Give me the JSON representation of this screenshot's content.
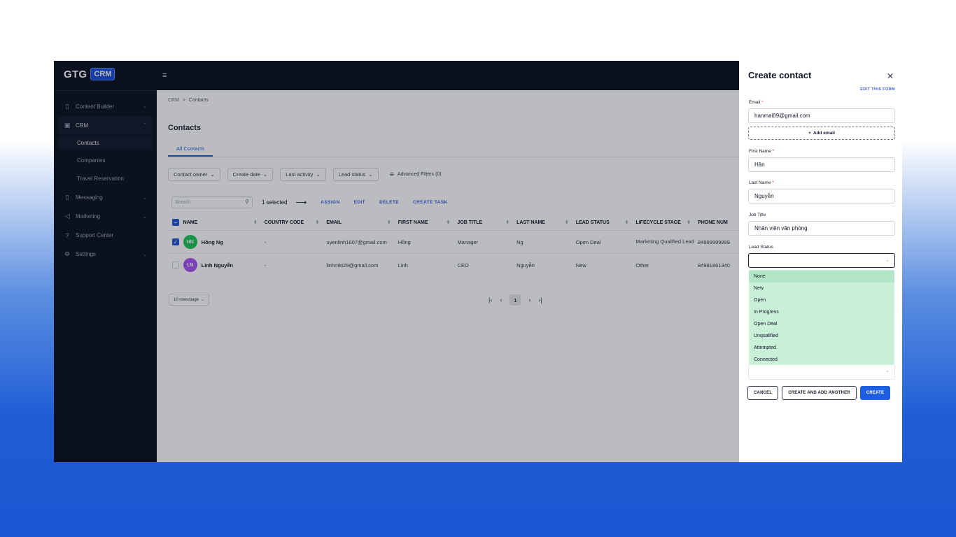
{
  "brand": {
    "name": "GTG",
    "badge": "CRM"
  },
  "sidebar": {
    "items": [
      {
        "label": "Content Builder",
        "icon": "bookmark-icon"
      },
      {
        "label": "CRM",
        "icon": "crm-icon"
      },
      {
        "label": "Messaging",
        "icon": "bookmark-icon"
      },
      {
        "label": "Marketing",
        "icon": "megaphone-icon"
      },
      {
        "label": "Support Center",
        "icon": "help-icon"
      },
      {
        "label": "Settings",
        "icon": "gear-icon"
      }
    ],
    "crm_sub": [
      "Contacts",
      "Companies",
      "Travel Reservation"
    ]
  },
  "breadcrumb": {
    "root": "CRM",
    "sep": ">",
    "current": "Contacts"
  },
  "page": {
    "title": "Contacts",
    "tab": "All Contacts"
  },
  "filters": [
    "Contact owner",
    "Create date",
    "Last activity",
    "Lead status"
  ],
  "advanced_filters": "Advanced Filters (0)",
  "toolbar": {
    "search_placeholder": "Search",
    "selected": "1 selected",
    "actions": [
      "ASSIGN",
      "EDIT",
      "DELETE",
      "CREATE TASK"
    ]
  },
  "table": {
    "headers": [
      "NAME",
      "COUNTRY CODE",
      "EMAIL",
      "FIRST NAME",
      "JOB TITLE",
      "LAST NAME",
      "LEAD STATUS",
      "LIFECYCLE STAGE",
      "PHONE NUM"
    ],
    "rows": [
      {
        "initials": "HN",
        "avatar_color": "#22c55e",
        "checked": true,
        "name": "Hồng Ng",
        "country": "-",
        "email": "uyenlinh1607@gmail.com",
        "first": "Hồng",
        "job": "Manager",
        "last": "Ng",
        "lead": "Open Deal",
        "stage": "Marketing Qualified Lead",
        "phone": "84999999999"
      },
      {
        "initials": "LN",
        "avatar_color": "#a855f7",
        "checked": false,
        "name": "Linh Nguyễn",
        "country": "-",
        "email": "linhmkt29@gmail.com",
        "first": "Linh",
        "job": "CEO",
        "last": "Nguyễn",
        "lead": "New",
        "stage": "Other",
        "phone": "84981861340"
      }
    ]
  },
  "pagination": {
    "rows_per_page": "10 rows/page",
    "page": "1"
  },
  "drawer": {
    "title": "Create contact",
    "edit_form": "EDIT THIS FORM",
    "email_label": "Email",
    "email_value": "hanmai09@gmail.com",
    "add_email": "Add email",
    "first_name_label": "First Name",
    "first_name_value": "Hân",
    "last_name_label": "Last Name",
    "last_name_value": "Nguyễn",
    "job_title_label": "Job Title",
    "job_title_value": "Nhân viên văn phòng",
    "lead_status_label": "Lead Status",
    "lead_status_options": [
      "None",
      "New",
      "Open",
      "In Progress",
      "Open Deal",
      "Unqualified",
      "Attempted",
      "Connected"
    ],
    "buttons": {
      "cancel": "CANCEL",
      "create_another": "CREATE AND ADD ANOTHER",
      "create": "CREATE"
    }
  }
}
